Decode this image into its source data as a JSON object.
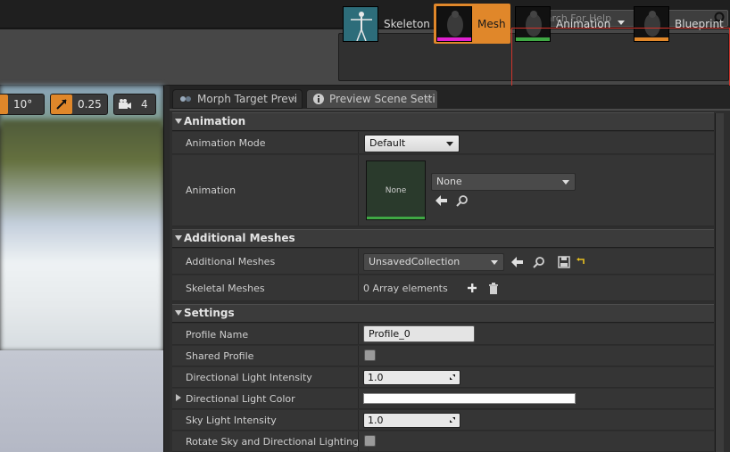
{
  "search": {
    "placeholder": "Search For Help"
  },
  "modes": [
    {
      "label": "Skeleton",
      "active": false,
      "stripe": ""
    },
    {
      "label": "Mesh",
      "active": true,
      "stripe": "#e020d0"
    },
    {
      "label": "Animation",
      "active": false,
      "stripe": "#3fa844"
    },
    {
      "label": "Blueprint",
      "active": false,
      "stripe": "#e0872a"
    }
  ],
  "viewport": {
    "angle_snap": "10°",
    "scale_snap": "0.25",
    "camera_speed": "4"
  },
  "tabs": [
    {
      "label": "Morph Target Previ",
      "close": "×"
    },
    {
      "label": "Preview Scene Setti",
      "close": "×"
    }
  ],
  "details": {
    "animation": {
      "header": "Animation",
      "mode_label": "Animation Mode",
      "mode_value": "Default",
      "anim_label": "Animation",
      "anim_thumb": "None",
      "anim_value": "None"
    },
    "additional": {
      "header": "Additional Meshes",
      "meshes_label": "Additional Meshes",
      "meshes_value": "UnsavedCollection",
      "skeletal_label": "Skeletal Meshes",
      "skeletal_value": "0 Array elements"
    },
    "settings": {
      "header": "Settings",
      "profile_label": "Profile Name",
      "profile_value": "Profile_0",
      "shared_label": "Shared Profile",
      "dir_int_label": "Directional Light Intensity",
      "dir_int_value": "1.0",
      "dir_color_label": "Directional Light Color",
      "sky_label": "Sky Light Intensity",
      "sky_value": "1.0",
      "rotate_label": "Rotate Sky and Directional Lighting"
    }
  }
}
